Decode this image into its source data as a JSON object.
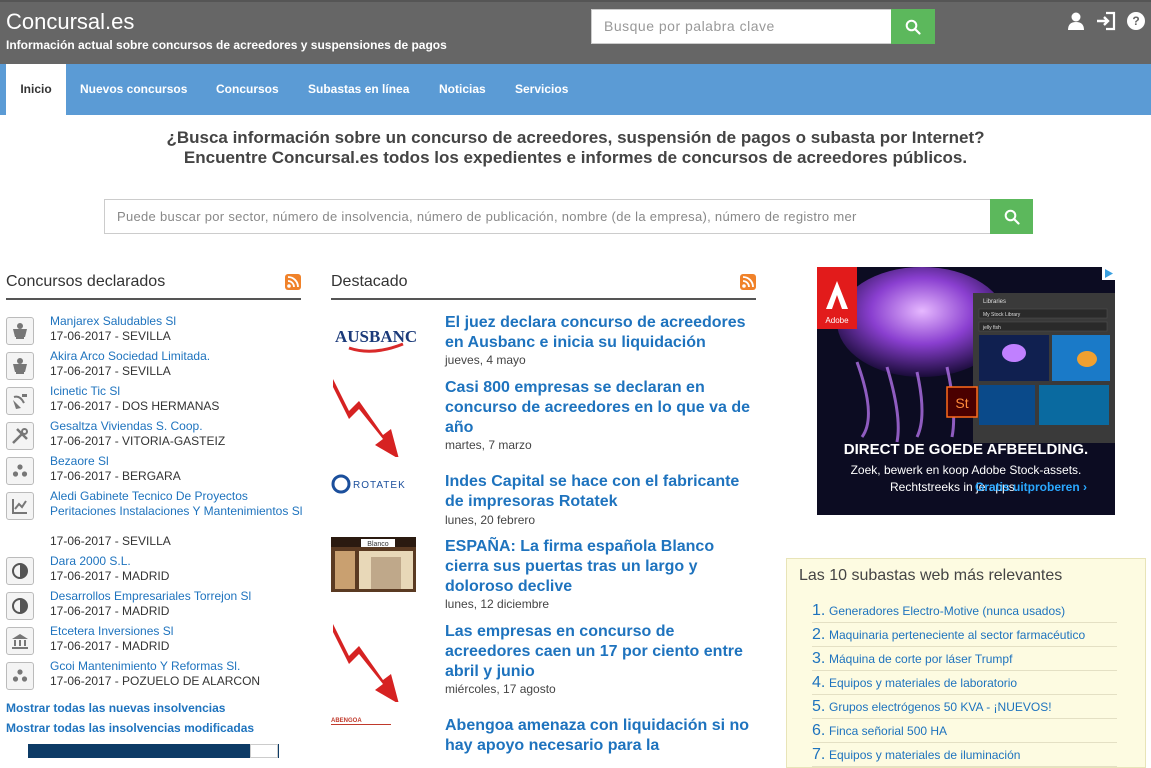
{
  "header": {
    "site_title": "Concursal.es",
    "subtitle": "Información actual sobre concursos de acreedores y suspensiones de pagos",
    "search_placeholder": "Busque por palabra clave",
    "search_icon": "search-icon",
    "icons": [
      "user-icon",
      "login-icon",
      "help-icon"
    ]
  },
  "nav": {
    "items": [
      {
        "label": "Inicio",
        "active": true
      },
      {
        "label": "Nuevos concursos"
      },
      {
        "label": "Concursos"
      },
      {
        "label": "Subastas en línea"
      },
      {
        "label": "Noticias"
      },
      {
        "label": "Servicios"
      }
    ]
  },
  "hero": {
    "line1": "¿Busca información sobre un concurso de acreedores, suspensión de pagos o subasta por Internet?",
    "line2": "Encuentre Concursal.es todos los expedientes e informes de concursos de acreedores públicos.",
    "search_placeholder": "Puede buscar por sector, número de insolvencia, número de publicación, nombre (de la empresa), número de registro mer"
  },
  "concursos": {
    "title": "Concursos declarados",
    "items": [
      {
        "name": "Manjarex Saludables Sl",
        "meta": "17-06-2017 - SEVILLA",
        "icon": "food-icon"
      },
      {
        "name": "Akira Arco Sociedad Limitada.",
        "meta": "17-06-2017 - SEVILLA",
        "icon": "food-icon"
      },
      {
        "name": "Icinetic Tic Sl",
        "meta": "17-06-2017 - DOS HERMANAS",
        "icon": "satellite-icon"
      },
      {
        "name": "Gesaltza Viviendas S. Coop.",
        "meta": "17-06-2017 - VITORIA-GASTEIZ",
        "icon": "tools-icon"
      },
      {
        "name": "Bezaore Sl",
        "meta": "17-06-2017 - BERGARA",
        "icon": "dots-icon"
      },
      {
        "name": "Aledi Gabinete Tecnico De Proyectos Peritaciones Instalaciones Y Mantenimientos Sl",
        "meta": "17-06-2017 - SEVILLA",
        "icon": "chart-icon"
      },
      {
        "name": "Dara 2000 S.L.",
        "meta": "17-06-2017 - MADRID",
        "icon": "pie-icon"
      },
      {
        "name": "Desarrollos Empresariales Torrejon Sl",
        "meta": "17-06-2017 - MADRID",
        "icon": "pie-icon"
      },
      {
        "name": "Etcetera Inversiones Sl",
        "meta": "17-06-2017 - MADRID",
        "icon": "bank-icon"
      },
      {
        "name": "Gcoi Mantenimiento Y Reformas Sl.",
        "meta": "17-06-2017 - POZUELO DE ALARCON",
        "icon": "dots-icon"
      }
    ],
    "link_new": "Mostrar todas las nuevas insolvencias",
    "link_modified": "Mostrar todas las insolvencias modificadas"
  },
  "destacado": {
    "title": "Destacado",
    "items": [
      {
        "title": "El juez declara concurso de acreedores en Ausbanc e inicia su liquidación",
        "date": "jueves, 4 mayo",
        "logo": "AUSBANC"
      },
      {
        "title": "Casi 800 empresas se declaran en concurso de acreedores en lo que va de año",
        "date": "martes, 7 marzo"
      },
      {
        "title": "Indes Capital se hace con el fabricante de impresoras Rotatek",
        "date": "lunes, 20 febrero",
        "logo": "ROTATEK"
      },
      {
        "title": "ESPAÑA: La firma española Blanco cierra sus puertas tras un largo y doloroso declive",
        "date": "lunes, 12 diciembre",
        "logo": "Blanco"
      },
      {
        "title": "Las empresas en concurso de acreedores caen un 17 por ciento entre abril y junio",
        "date": "miércoles, 17 agosto"
      },
      {
        "title": "Abengoa amenaza con liquidación si no hay apoyo necesario para la",
        "date": "",
        "logo": "ABENGOA"
      }
    ]
  },
  "ad": {
    "brand": "Adobe",
    "panel_title": "Libraries",
    "panel_select": "My Stock Library",
    "panel_search": "jelly fish",
    "st_label": "St",
    "headline": "DIRECT DE GOEDE AFBEELDING.",
    "line1": "Zoek, bewerk en koop Adobe Stock-assets.",
    "line2": "Rechtstreeks in je apps.",
    "cta": "Gratis uitproberen ›"
  },
  "subastas": {
    "title": "Las 10 subastas web más relevantes",
    "items": [
      "Generadores Electro-Motive (nunca usados)",
      "Maquinaria perteneciente al sector farmacéutico",
      "Máquina de corte por láser Trumpf",
      "Equipos y materiales de laboratorio",
      "Grupos electrógenos 50 KVA - ¡NUEVOS!",
      "Finca señorial 500 HA",
      "Equipos y materiales de iluminación"
    ]
  }
}
